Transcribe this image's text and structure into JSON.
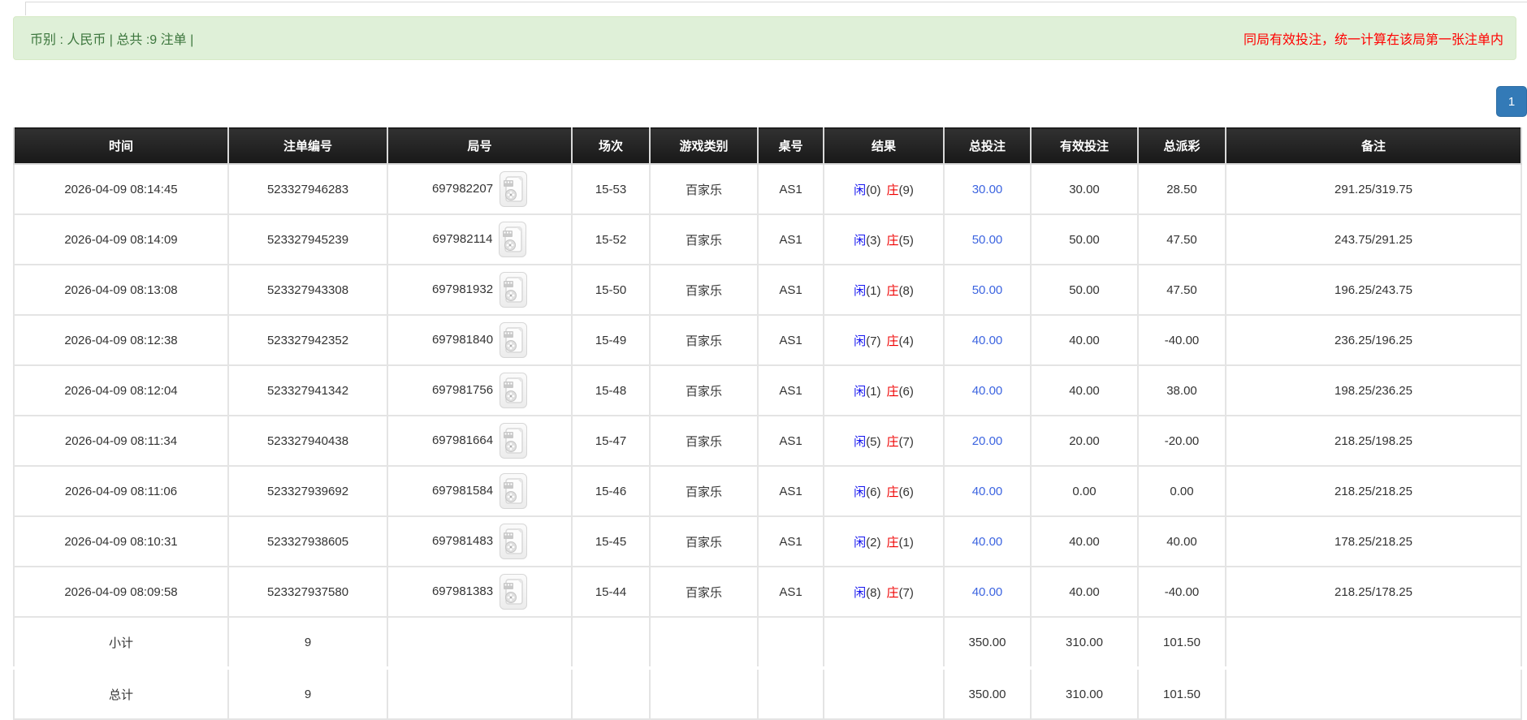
{
  "banner": {
    "left_text": "币别 : 人民币 | 总共 :9 注单 |",
    "right_text": "同局有效投注，统一计算在该局第一张注单内",
    "bg_color": "#dff0d8",
    "left_text_color": "#3c763d",
    "right_text_color": "#ff0000"
  },
  "pagination": {
    "current_page": "1",
    "accent_color": "#337ab7"
  },
  "table": {
    "headers": [
      "时间",
      "注单编号",
      "局号",
      "场次",
      "游戏类别",
      "桌号",
      "结果",
      "总投注",
      "有效投注",
      "总派彩",
      "备注"
    ],
    "result_labels": {
      "player": "闲",
      "banker": "庄"
    },
    "video_icon": "film-replay-icon",
    "highlight_color": "#f5f2a1",
    "rows": [
      {
        "time": "2026-04-09 08:14:45",
        "bet_id": "523327946283",
        "round": "697982207",
        "session": "15-53",
        "game": "百家乐",
        "table_no": "AS1",
        "p_num": "(0)",
        "b_num": "(9)",
        "total_bet": "30.00",
        "valid_bet": "30.00",
        "payout": "28.50",
        "remark": "291.25/319.75"
      },
      {
        "time": "2026-04-09 08:14:09",
        "bet_id": "523327945239",
        "round": "697982114",
        "session": "15-52",
        "game": "百家乐",
        "table_no": "AS1",
        "p_num": "(3)",
        "b_num": "(5)",
        "total_bet": "50.00",
        "valid_bet": "50.00",
        "payout": "47.50",
        "remark": "243.75/291.25"
      },
      {
        "time": "2026-04-09 08:13:08",
        "bet_id": "523327943308",
        "round": "697981932",
        "session": "15-50",
        "game": "百家乐",
        "table_no": "AS1",
        "p_num": "(1)",
        "b_num": "(8)",
        "total_bet": "50.00",
        "valid_bet": "50.00",
        "payout": "47.50",
        "remark": "196.25/243.75"
      },
      {
        "time": "2026-04-09 08:12:38",
        "bet_id": "523327942352",
        "round": "697981840",
        "session": "15-49",
        "game": "百家乐",
        "table_no": "AS1",
        "p_num": "(7)",
        "b_num": "(4)",
        "total_bet": "40.00",
        "valid_bet": "40.00",
        "payout": "-40.00",
        "remark": "236.25/196.25"
      },
      {
        "time": "2026-04-09 08:12:04",
        "bet_id": "523327941342",
        "round": "697981756",
        "session": "15-48",
        "game": "百家乐",
        "table_no": "AS1",
        "p_num": "(1)",
        "b_num": "(6)",
        "total_bet": "40.00",
        "valid_bet": "40.00",
        "payout": "38.00",
        "remark": "198.25/236.25"
      },
      {
        "time": "2026-04-09 08:11:34",
        "bet_id": "523327940438",
        "round": "697981664",
        "session": "15-47",
        "game": "百家乐",
        "table_no": "AS1",
        "p_num": "(5)",
        "b_num": "(7)",
        "total_bet": "20.00",
        "valid_bet": "20.00",
        "payout": "-20.00",
        "remark": "218.25/198.25"
      },
      {
        "time": "2026-04-09 08:11:06",
        "bet_id": "523327939692",
        "round": "697981584",
        "session": "15-46",
        "game": "百家乐",
        "table_no": "AS1",
        "p_num": "(6)",
        "b_num": "(6)",
        "total_bet": "40.00",
        "valid_bet": "0.00",
        "payout": "0.00",
        "remark": "218.25/218.25"
      },
      {
        "time": "2026-04-09 08:10:31",
        "bet_id": "523327938605",
        "round": "697981483",
        "session": "15-45",
        "game": "百家乐",
        "table_no": "AS1",
        "p_num": "(2)",
        "b_num": "(1)",
        "total_bet": "40.00",
        "valid_bet": "40.00",
        "payout": "40.00",
        "remark": "178.25/218.25"
      },
      {
        "time": "2026-04-09 08:09:58",
        "bet_id": "523327937580",
        "round": "697981383",
        "session": "15-44",
        "game": "百家乐",
        "table_no": "AS1",
        "p_num": "(8)",
        "b_num": "(7)",
        "total_bet": "40.00",
        "valid_bet": "40.00",
        "payout": "-40.00",
        "remark": "218.25/178.25"
      }
    ],
    "subtotal": {
      "label": "小计",
      "count": "9",
      "total_bet": "350.00",
      "valid_bet": "310.00",
      "payout": "101.50"
    },
    "total": {
      "label": "总计",
      "count": "9",
      "total_bet": "350.00",
      "valid_bet": "310.00",
      "payout": "101.50"
    }
  }
}
